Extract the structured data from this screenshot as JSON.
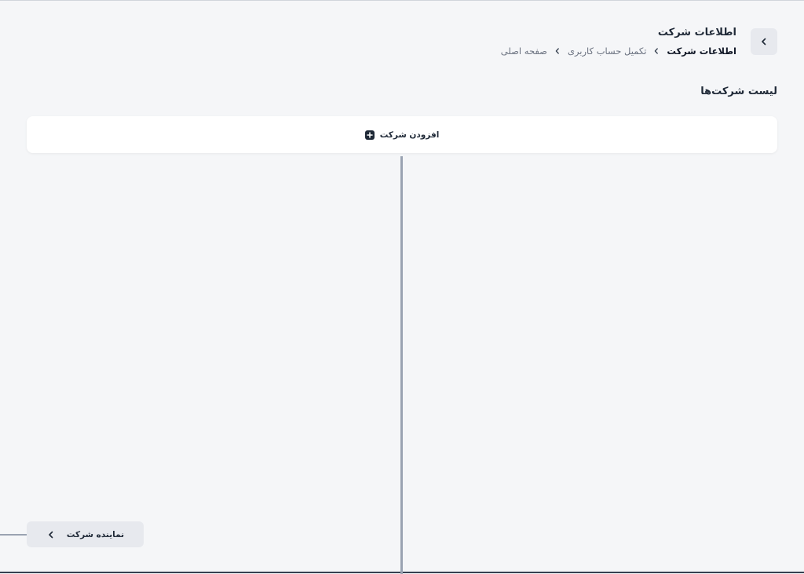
{
  "header": {
    "title": "اطلاعات شرکت",
    "back_icon": "chevron-left-icon",
    "breadcrumb": [
      {
        "label": "صفحه اصلی"
      },
      {
        "label": "تکمیل حساب کاربری"
      },
      {
        "label": "اطلاعات شرکت"
      }
    ]
  },
  "section": {
    "title": "لیست شرکت‌ها"
  },
  "add_company": {
    "label": "افزودن شرکت",
    "icon": "plus-icon"
  },
  "tree": {
    "node_label": "نماینده شرکت",
    "node_icon": "chevron-left-icon"
  },
  "colors": {
    "background": "#f5f6f8",
    "card": "#ffffff",
    "button_bg": "#e7e9ee",
    "connector": "#9aa3b2",
    "text_primary": "#1f2937",
    "text_muted": "#6b7280"
  }
}
